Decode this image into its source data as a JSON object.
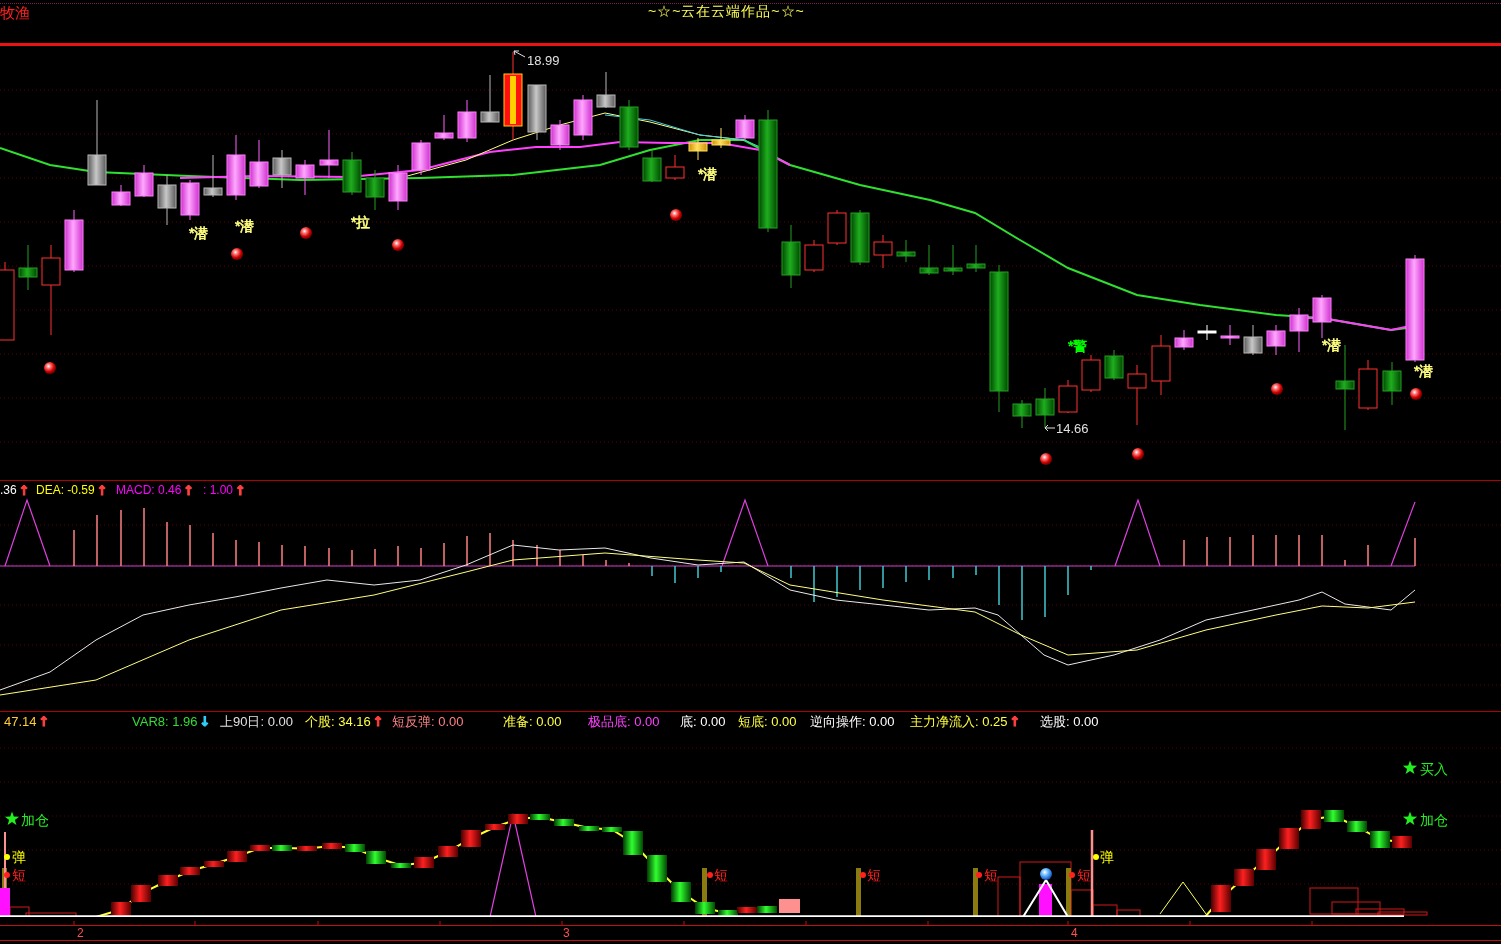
{
  "header": {
    "corner_label": "牧渔",
    "title": "~☆~云在云端作品~☆~"
  },
  "price_chart": {
    "high_label": "18.99",
    "low_label": "14.66",
    "signals": [
      {
        "text": "*潜",
        "color": "#ffff80"
      },
      {
        "text": "*潜",
        "color": "#ffff80"
      },
      {
        "text": "*拉",
        "color": "#ffff80"
      },
      {
        "text": "*潜",
        "color": "#ffff80"
      },
      {
        "text": "*警",
        "color": "#00ff00"
      },
      {
        "text": "*潜",
        "color": "#ffff80"
      },
      {
        "text": "*潜",
        "color": "#ffff80"
      }
    ]
  },
  "macd_panel": {
    "readouts": [
      {
        "text": ".36",
        "arrow": {
          "text": "↑",
          "color": "#ff4040"
        },
        "color": "#ffffff"
      },
      {
        "text": "DEA: -0.59",
        "arrow": {
          "text": "↑",
          "color": "#ff4040"
        },
        "color": "#ffff00"
      },
      {
        "text": "MACD: 0.46",
        "arrow": {
          "text": "↑",
          "color": "#ff4040"
        },
        "color": "#ff00ff"
      },
      {
        "text": ": 1.00",
        "arrow": {
          "text": "↑",
          "color": "#ff4040"
        },
        "color": "#ff00ff"
      }
    ]
  },
  "signal_panel": {
    "readouts": [
      {
        "text": "47.14",
        "arrow": {
          "text": "↑",
          "color": "#ff4040"
        },
        "color": "#ffcc33"
      },
      {
        "text": "VAR8: 1.96",
        "arrow": {
          "text": "↓",
          "color": "#30d0ff"
        },
        "color": "#33dd33"
      },
      {
        "text": "上90日: 0.00",
        "color": "#e0e0e0"
      },
      {
        "text": "个股: 34.16",
        "arrow": {
          "text": "↑",
          "color": "#ff4040"
        },
        "color": "#ffff40"
      },
      {
        "text": "短反弹: 0.00",
        "color": "#ff8080"
      },
      {
        "text": "准备: 0.00",
        "color": "#ffff40"
      },
      {
        "text": "极品底: 0.00",
        "color": "#ff40ff"
      },
      {
        "text": "底: 0.00",
        "color": "#ffffff"
      },
      {
        "text": "短底: 0.00",
        "color": "#ffff40"
      },
      {
        "text": "逆向操作: 0.00",
        "color": "#ffffff"
      },
      {
        "text": "主力净流入: 0.25",
        "arrow": {
          "text": "↑",
          "color": "#ff4040"
        },
        "color": "#ffff40"
      },
      {
        "text": "选股: 0.00",
        "color": "#ffffff"
      }
    ],
    "markers": [
      {
        "text": "加仓",
        "kind": "star"
      },
      {
        "text": "弹",
        "kind": "dot",
        "color": "#ffff00"
      },
      {
        "text": "短",
        "kind": "dot",
        "color": "#ff2020"
      },
      {
        "text": "短",
        "kind": "dot",
        "color": "#ff2020"
      },
      {
        "text": "短",
        "kind": "dot",
        "color": "#ff2020"
      },
      {
        "text": "短",
        "kind": "dot",
        "color": "#ff2020"
      },
      {
        "text": "短",
        "kind": "dot",
        "color": "#ff2020"
      },
      {
        "text": "弹",
        "kind": "dot",
        "color": "#ffff00"
      },
      {
        "text": "买入",
        "kind": "star"
      },
      {
        "text": "加仓",
        "kind": "star"
      }
    ]
  },
  "time_axis": {
    "labels": [
      "2",
      "3",
      "4"
    ]
  }
}
